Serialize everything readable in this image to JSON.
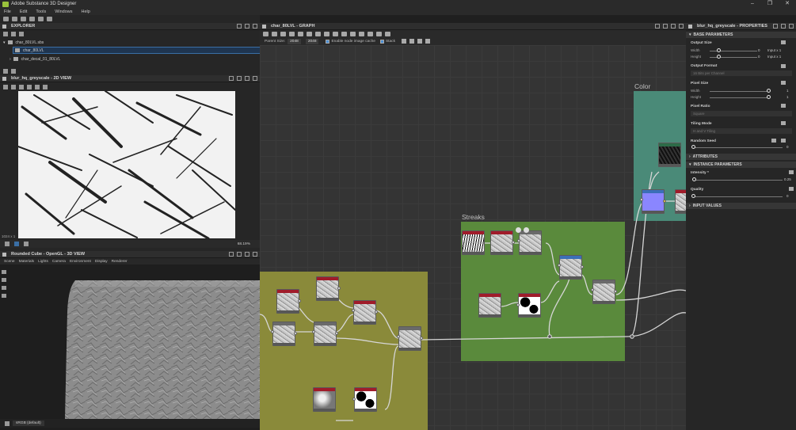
{
  "app": {
    "title": "Adobe Substance 3D Designer"
  },
  "menu": [
    "File",
    "Edit",
    "Tools",
    "Windows",
    "Help"
  ],
  "explorer": {
    "title": "EXPLORER",
    "package": "char_80LVL.sbs",
    "items": [
      "char_80LVL",
      "char_decal_01_80LVL"
    ]
  },
  "view2d": {
    "title": "blur_hq_greyscale - 2D VIEW",
    "resolution": "1024 x 1",
    "zoom": "68.19%"
  },
  "view3d": {
    "title": "Rounded Cube - OpenGL - 3D VIEW",
    "menu": [
      "Scene",
      "Materials",
      "Lights",
      "Camera",
      "Environment",
      "Display",
      "Renderer"
    ],
    "colorspace": "sRGB (default)"
  },
  "graph": {
    "title": "char_80LVL - GRAPH",
    "parent_size_label": "Parent Size:",
    "parent_size": "2048",
    "size2": "2048",
    "cache_label": "Enable node image cache",
    "stack_label": "Stack",
    "frames": {
      "color": "Color",
      "streaks": "Streaks"
    }
  },
  "properties": {
    "title": "blur_hq_greyscale - PROPERTIES",
    "sections": {
      "base": "BASE PARAMETERS",
      "attributes": "ATTRIBUTES",
      "instance": "INSTANCE PARAMETERS",
      "inputs": "INPUT VALUES"
    },
    "output_size": {
      "label": "Output Size",
      "width_label": "Width",
      "height_label": "Height",
      "width_value": "0",
      "height_value": "0",
      "width_mode": "Input x 1",
      "height_mode": "Input x 1"
    },
    "output_format": {
      "label": "Output Format",
      "value": "16 Bits per Channel"
    },
    "pixel_size": {
      "label": "Pixel Size",
      "width_label": "Width",
      "height_label": "Height",
      "width_value": "1",
      "height_value": "1"
    },
    "pixel_ratio": {
      "label": "Pixel Ratio",
      "value": "Square"
    },
    "tiling_mode": {
      "label": "Tiling Mode",
      "value": "H and V Tiling"
    },
    "random_seed": {
      "label": "Random Seed",
      "value": "0"
    },
    "intensity": {
      "label": "Intensity *",
      "value": "0.25"
    },
    "quality": {
      "label": "Quality",
      "value": "0"
    }
  },
  "colors": {
    "yellow_frame": "#8a8a3a",
    "green_frame": "#5a8a3c",
    "teal_frame": "#4a8a78",
    "node_header_red": "#a01c2a",
    "accent_blue": "#3a6fa5"
  }
}
